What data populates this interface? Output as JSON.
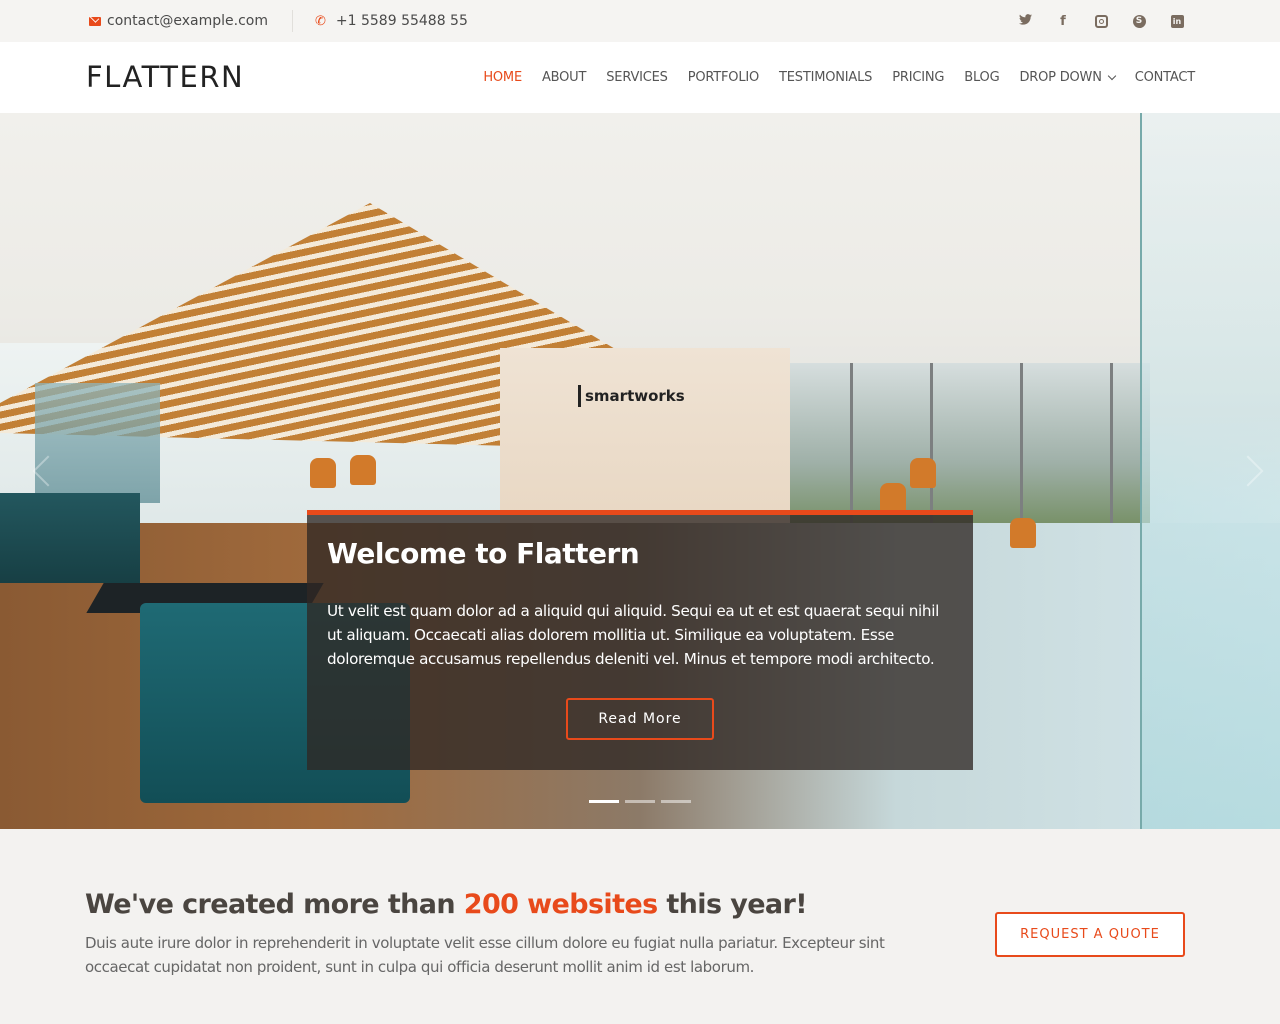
{
  "topbar": {
    "email": "contact@example.com",
    "phone": "+1 5589 55488 55",
    "socials": [
      {
        "name": "twitter-icon",
        "glyph": "🐦"
      },
      {
        "name": "facebook-icon",
        "glyph": "f"
      },
      {
        "name": "instagram-icon",
        "glyph": ""
      },
      {
        "name": "skype-icon",
        "glyph": "S"
      },
      {
        "name": "linkedin-icon",
        "glyph": "in"
      }
    ]
  },
  "header": {
    "logo": "FLATTERN",
    "nav": [
      {
        "label": "HOME",
        "active": true
      },
      {
        "label": "ABOUT"
      },
      {
        "label": "SERVICES"
      },
      {
        "label": "PORTFOLIO"
      },
      {
        "label": "TESTIMONIALS"
      },
      {
        "label": "PRICING"
      },
      {
        "label": "BLOG"
      },
      {
        "label": "DROP DOWN",
        "dropdown": true
      },
      {
        "label": "CONTACT"
      }
    ]
  },
  "hero": {
    "sign_text": "smartworks",
    "title": "Welcome to Flattern",
    "text": "Ut velit est quam dolor ad a aliquid qui aliquid. Sequi ea ut et est quaerat sequi nihil ut aliquam. Occaecati alias dolorem mollitia ut. Similique ea voluptatem. Esse doloremque accusamus repellendus deleniti vel. Minus et tempore modi architecto.",
    "button": "Read More",
    "slides": 3,
    "active_slide": 1
  },
  "cta": {
    "title_before": "We've created more than ",
    "title_highlight": "200 websites",
    "title_after": " this year!",
    "text": "Duis aute irure dolor in reprehenderit in voluptate velit esse cillum dolore eu fugiat nulla pariatur. Excepteur sint occaecat cupidatat non proident, sunt in culpa qui officia deserunt mollit anim id est laborum.",
    "button": "REQUEST A QUOTE"
  },
  "colors": {
    "accent": "#e84a1b",
    "topbar_bg": "#f5f4f2",
    "caption_bg": "#302824"
  }
}
